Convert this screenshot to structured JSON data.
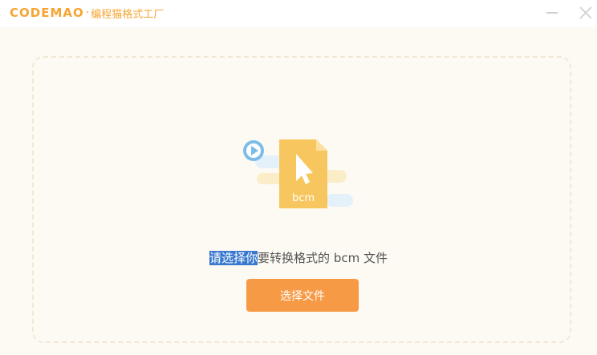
{
  "titlebar": {
    "logo_text": "CODEMAO",
    "separator": "·",
    "app_name": "编程猫格式工厂",
    "minimize_icon": "minimize-icon",
    "close_icon": "close-icon"
  },
  "main": {
    "illustration": {
      "file_label": "bcm",
      "icons": [
        "play-icon",
        "cursor-icon",
        "bcm-file-icon"
      ]
    },
    "prompt_selected": "请选择你",
    "prompt_rest": "要转换格式的 bcm 文件",
    "select_button_label": "选择文件"
  },
  "colors": {
    "brand": "#f7a433",
    "button": "#f79a45",
    "selection": "#3a78cf",
    "background": "#fdfaf3"
  }
}
